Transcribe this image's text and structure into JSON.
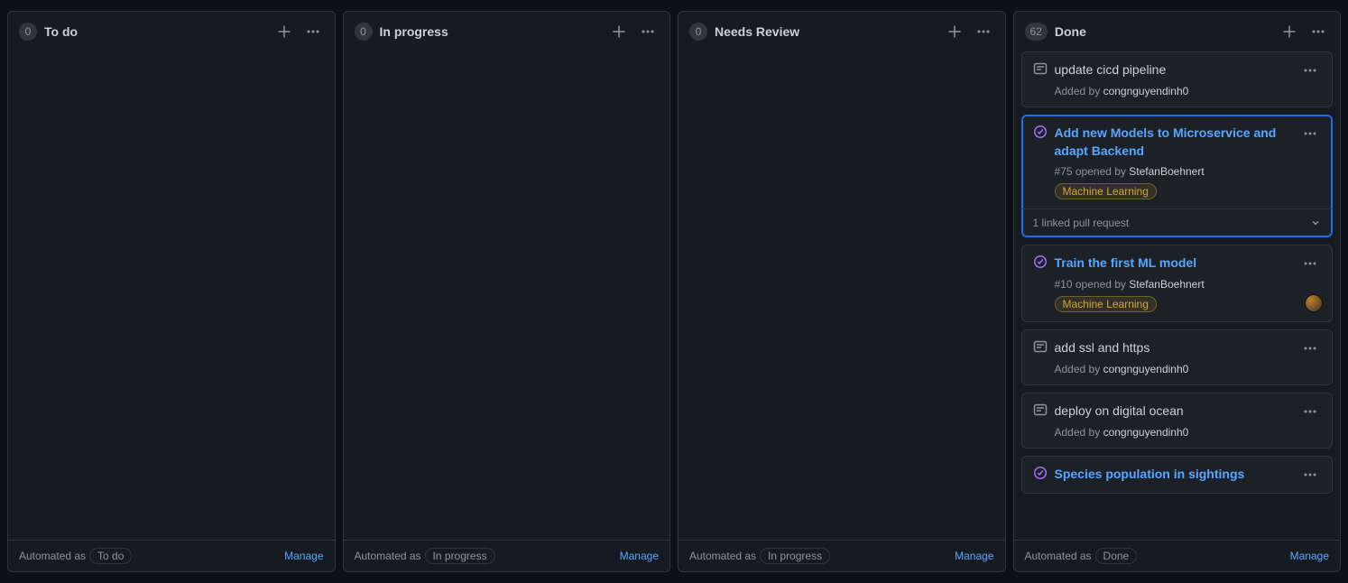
{
  "columns": [
    {
      "count": "0",
      "title": "To do",
      "automated_prefix": "Automated as",
      "automated_label": "To do",
      "manage": "Manage",
      "cards": []
    },
    {
      "count": "0",
      "title": "In progress",
      "automated_prefix": "Automated as",
      "automated_label": "In progress",
      "manage": "Manage",
      "cards": []
    },
    {
      "count": "0",
      "title": "Needs Review",
      "automated_prefix": "Automated as",
      "automated_label": "In progress",
      "manage": "Manage",
      "cards": []
    },
    {
      "count": "62",
      "title": "Done",
      "automated_prefix": "Automated as",
      "automated_label": "Done",
      "manage": "Manage",
      "cards": [
        {
          "type": "note",
          "icon": "note",
          "title": "update cicd pipeline",
          "added_prefix": "Added by",
          "added_by": "congnguyendinh0"
        },
        {
          "type": "issue",
          "icon": "closed",
          "selected": true,
          "title": "Add new Models to Microservice and adapt Backend",
          "ref": "#75",
          "opened_text": "opened by",
          "author": "StefanBoehnert",
          "labels": [
            "Machine Learning"
          ],
          "linked_text": "1 linked pull request"
        },
        {
          "type": "issue",
          "icon": "closed",
          "title": "Train the first ML model",
          "ref": "#10",
          "opened_text": "opened by",
          "author": "StefanBoehnert",
          "labels": [
            "Machine Learning"
          ],
          "avatar": true
        },
        {
          "type": "note",
          "icon": "note",
          "title": "add ssl and https",
          "added_prefix": "Added by",
          "added_by": "congnguyendinh0"
        },
        {
          "type": "note",
          "icon": "note",
          "title": "deploy on digital ocean",
          "added_prefix": "Added by",
          "added_by": "congnguyendinh0"
        },
        {
          "type": "issue",
          "icon": "closed",
          "title": "Species population in sightings",
          "ref": "",
          "opened_text": "",
          "author": "",
          "labels": []
        }
      ]
    }
  ]
}
